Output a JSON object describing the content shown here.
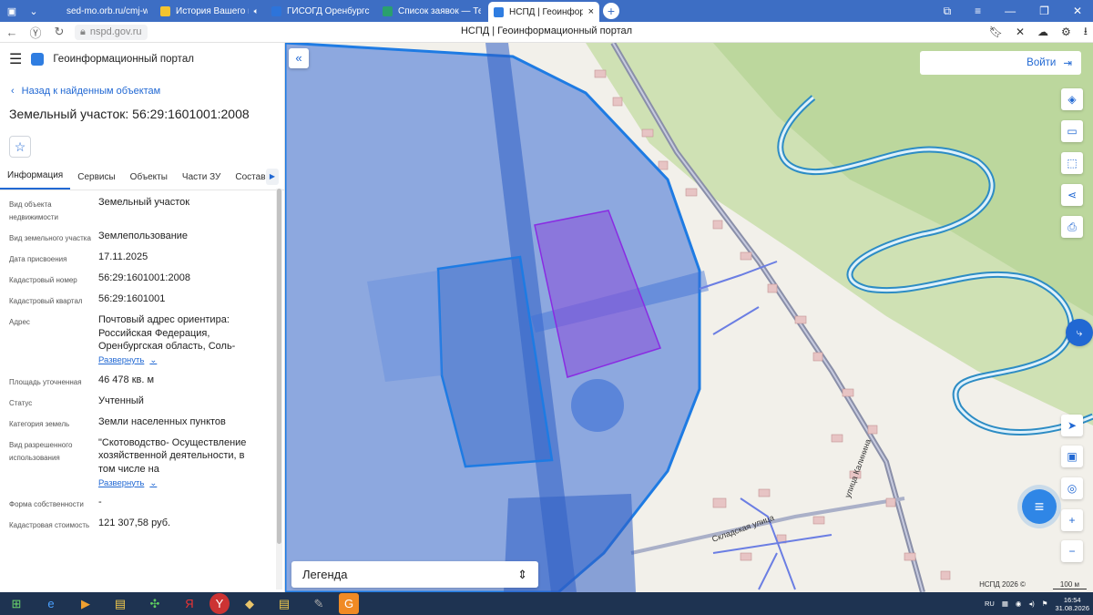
{
  "browser": {
    "tabs": [
      {
        "label": "sed-mo.orb.ru/cmj-web/?",
        "favicon_color": "#3d6ec4",
        "has_audio": false,
        "active": false
      },
      {
        "label": "История Вашего му",
        "favicon_color": "#f4c430",
        "has_audio": true,
        "active": false
      },
      {
        "label": "ГИСОГД Оренбургской о",
        "favicon_color": "#2d74da",
        "has_audio": false,
        "active": false
      },
      {
        "label": "Список заявок — ТехноК",
        "favicon_color": "#2aa06e",
        "has_audio": false,
        "active": false
      },
      {
        "label": "НСПД | Геоинформац",
        "favicon_color": "#2f7de1",
        "has_audio": false,
        "active": true
      }
    ],
    "url": "nspd.gov.ru",
    "page_title": "НСПД | Геоинформационный портал"
  },
  "panel": {
    "header_title": "Геоинформационный портал",
    "back_link": "Назад к найденным объектам",
    "object_title": "Земельный участок: 56:29:1601001:2008",
    "tabs": [
      "Информация",
      "Сервисы",
      "Объекты",
      "Части ЗУ",
      "Состав"
    ],
    "properties": [
      {
        "key": "Вид объекта недвижимости",
        "value": "Земельный участок",
        "expand": ""
      },
      {
        "key": "Вид земельного участка",
        "value": "Землепользование",
        "expand": ""
      },
      {
        "key": "Дата присвоения",
        "value": "17.11.2025",
        "expand": ""
      },
      {
        "key": "Кадастровый номер",
        "value": "56:29:1601001:2008",
        "expand": ""
      },
      {
        "key": "Кадастровый квартал",
        "value": "56:29:1601001",
        "expand": ""
      },
      {
        "key": "Адрес",
        "value": "Почтовый адрес ориентира: Российская Федерация, Оренбургская область, Соль-",
        "expand": "Развернуть"
      },
      {
        "key": "Площадь уточненная",
        "value": "46 478 кв. м",
        "expand": ""
      },
      {
        "key": "Статус",
        "value": "Учтенный",
        "expand": ""
      },
      {
        "key": "Категория земель",
        "value": "Земли населенных пунктов",
        "expand": ""
      },
      {
        "key": "Вид разрешенного использования",
        "value": "\"Скотоводство- Осуществление хозяйственной деятельности, в том числе на сельскохозяйственных",
        "expand": "Развернуть"
      },
      {
        "key": "Форма собственности",
        "value": "-",
        "expand": ""
      },
      {
        "key": "Кадастровая стоимость",
        "value": "121 307,58 руб.",
        "expand": ""
      }
    ]
  },
  "map": {
    "login_label": "Войти",
    "legend_label": "Легенда",
    "street_labels": [
      "Складская улица",
      "улица Калинина"
    ],
    "attribution": "НСПД 2026 ©",
    "scale_label": "100 м",
    "tools": [
      "layers-icon",
      "ruler-icon",
      "select-icon",
      "share-icon",
      "print-icon",
      "locate-icon",
      "minimap-icon",
      "pin-icon",
      "zoom-in-icon",
      "zoom-out-icon"
    ],
    "colors": {
      "selection": "#8a2be2",
      "parcel": "#1e7be3",
      "zone": "#3b6ed6"
    }
  },
  "taskbar": {
    "lang": "RU",
    "time": "16:54",
    "date": "31.08.2026"
  }
}
